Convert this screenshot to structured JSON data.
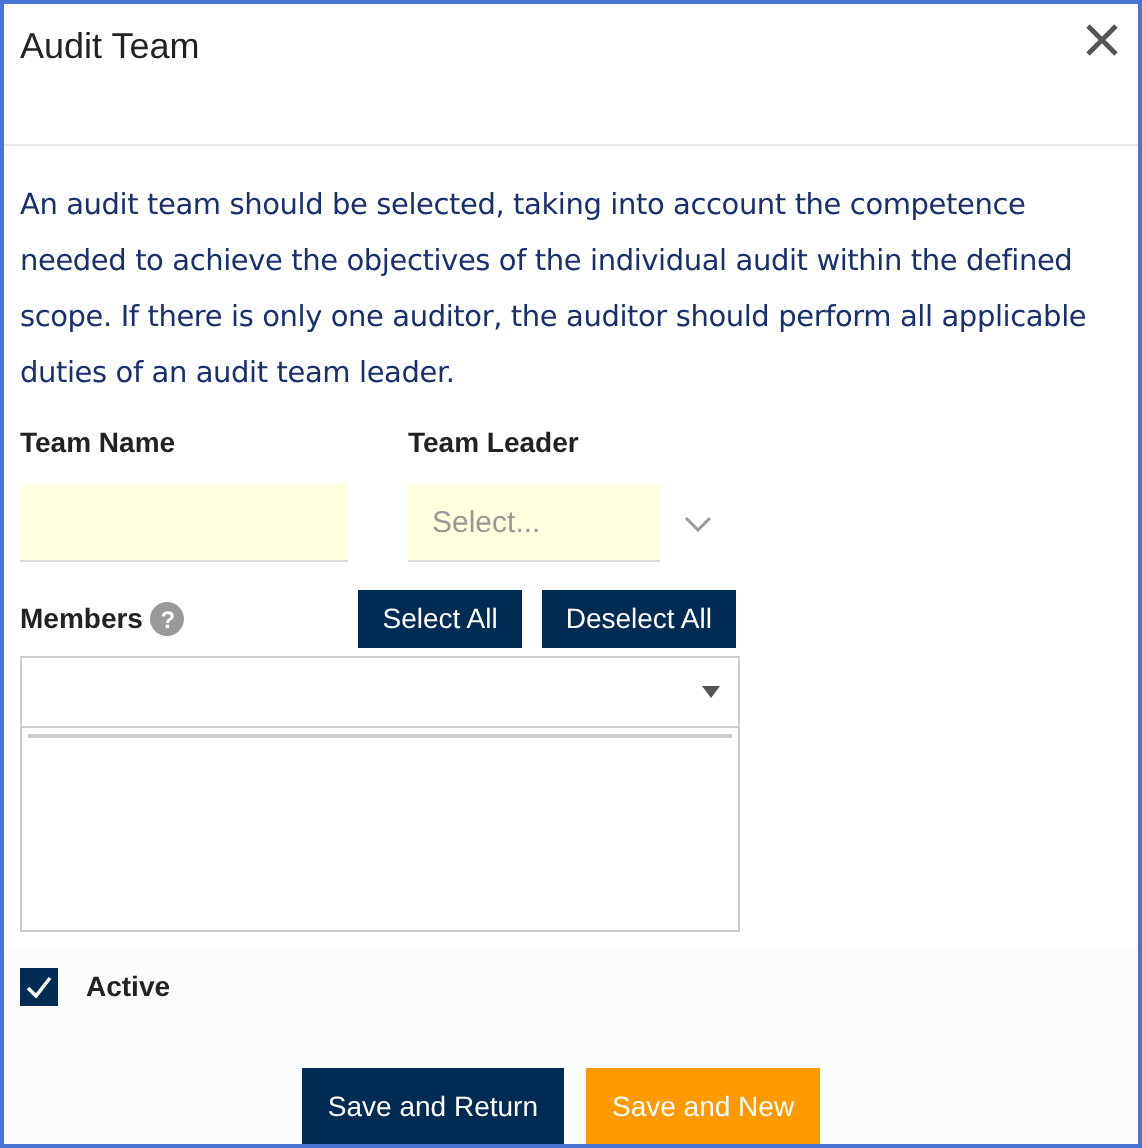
{
  "dialog": {
    "title": "Audit Team"
  },
  "description": "An audit team should be selected, taking into account the competence needed to achieve the objectives of the individual audit within the defined scope. If there is only one auditor, the auditor should perform all applicable duties of an audit team leader.",
  "team_name": {
    "label": "Team Name"
  },
  "team_leader": {
    "label": "Team Leader",
    "placeholder": "Select..."
  },
  "members": {
    "label": "Members",
    "help": "?",
    "buttons": [
      "Select All",
      "Deselect All"
    ]
  },
  "active": {
    "label": "Active",
    "checked": true
  },
  "footer_buttons": [
    {
      "label": "Save and Return",
      "kind": "primary"
    },
    {
      "label": "Save and New",
      "kind": "accent"
    }
  ]
}
